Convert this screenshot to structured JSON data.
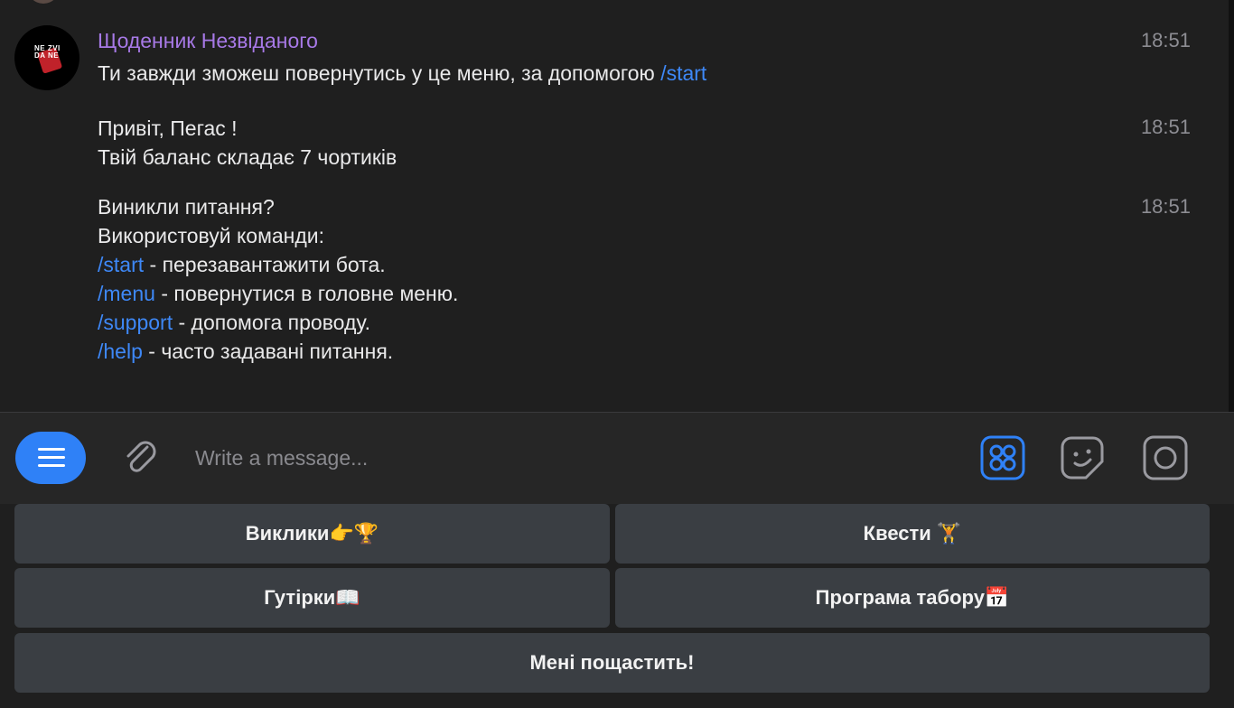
{
  "chat": {
    "sender": "Щоденник Незвіданого",
    "avatar_text": "NE ZVI DA NE",
    "messages": [
      {
        "time": "18:51",
        "lines": [
          {
            "parts": [
              {
                "text": "Ти завжди зможеш повернутись у це меню, за допомогою "
              },
              {
                "text": "/start",
                "cmd": true
              }
            ]
          }
        ]
      },
      {
        "time": "18:51",
        "lines": [
          {
            "parts": [
              {
                "text": "Привіт, Пегас !"
              }
            ]
          },
          {
            "parts": [
              {
                "text": "Твій баланс складає 7 чортиків"
              }
            ]
          }
        ]
      },
      {
        "time": "18:51",
        "lines": [
          {
            "parts": [
              {
                "text": "Виникли питання?"
              }
            ]
          },
          {
            "parts": [
              {
                "text": "Використовуй команди:"
              }
            ]
          },
          {
            "parts": [
              {
                "text": "/start",
                "cmd": true
              },
              {
                "text": " - перезавантажити бота."
              }
            ]
          },
          {
            "parts": [
              {
                "text": "/menu",
                "cmd": true
              },
              {
                "text": " - повернутися в головне меню."
              }
            ]
          },
          {
            "parts": [
              {
                "text": "/support",
                "cmd": true
              },
              {
                "text": " - допомога проводу."
              }
            ]
          },
          {
            "parts": [
              {
                "text": "/help",
                "cmd": true
              },
              {
                "text": " - часто задавані питання."
              }
            ]
          }
        ]
      }
    ]
  },
  "composer": {
    "placeholder": "Write a message...",
    "icons": [
      "menu-icon",
      "paperclip-icon",
      "bot-apps-icon",
      "sticker-icon",
      "camera-icon"
    ]
  },
  "keyboard": {
    "buttons": [
      "Виклики👉🏆",
      "Квести 🏋",
      "Гутірки📖",
      "Програма табору📅",
      "Мені пощастить!"
    ]
  },
  "colors": {
    "accent": "#2f81f7",
    "sender": "#a779e6",
    "command": "#3e88f7",
    "background": "#1f1f1f",
    "keyboard_button": "#3a3e43"
  }
}
